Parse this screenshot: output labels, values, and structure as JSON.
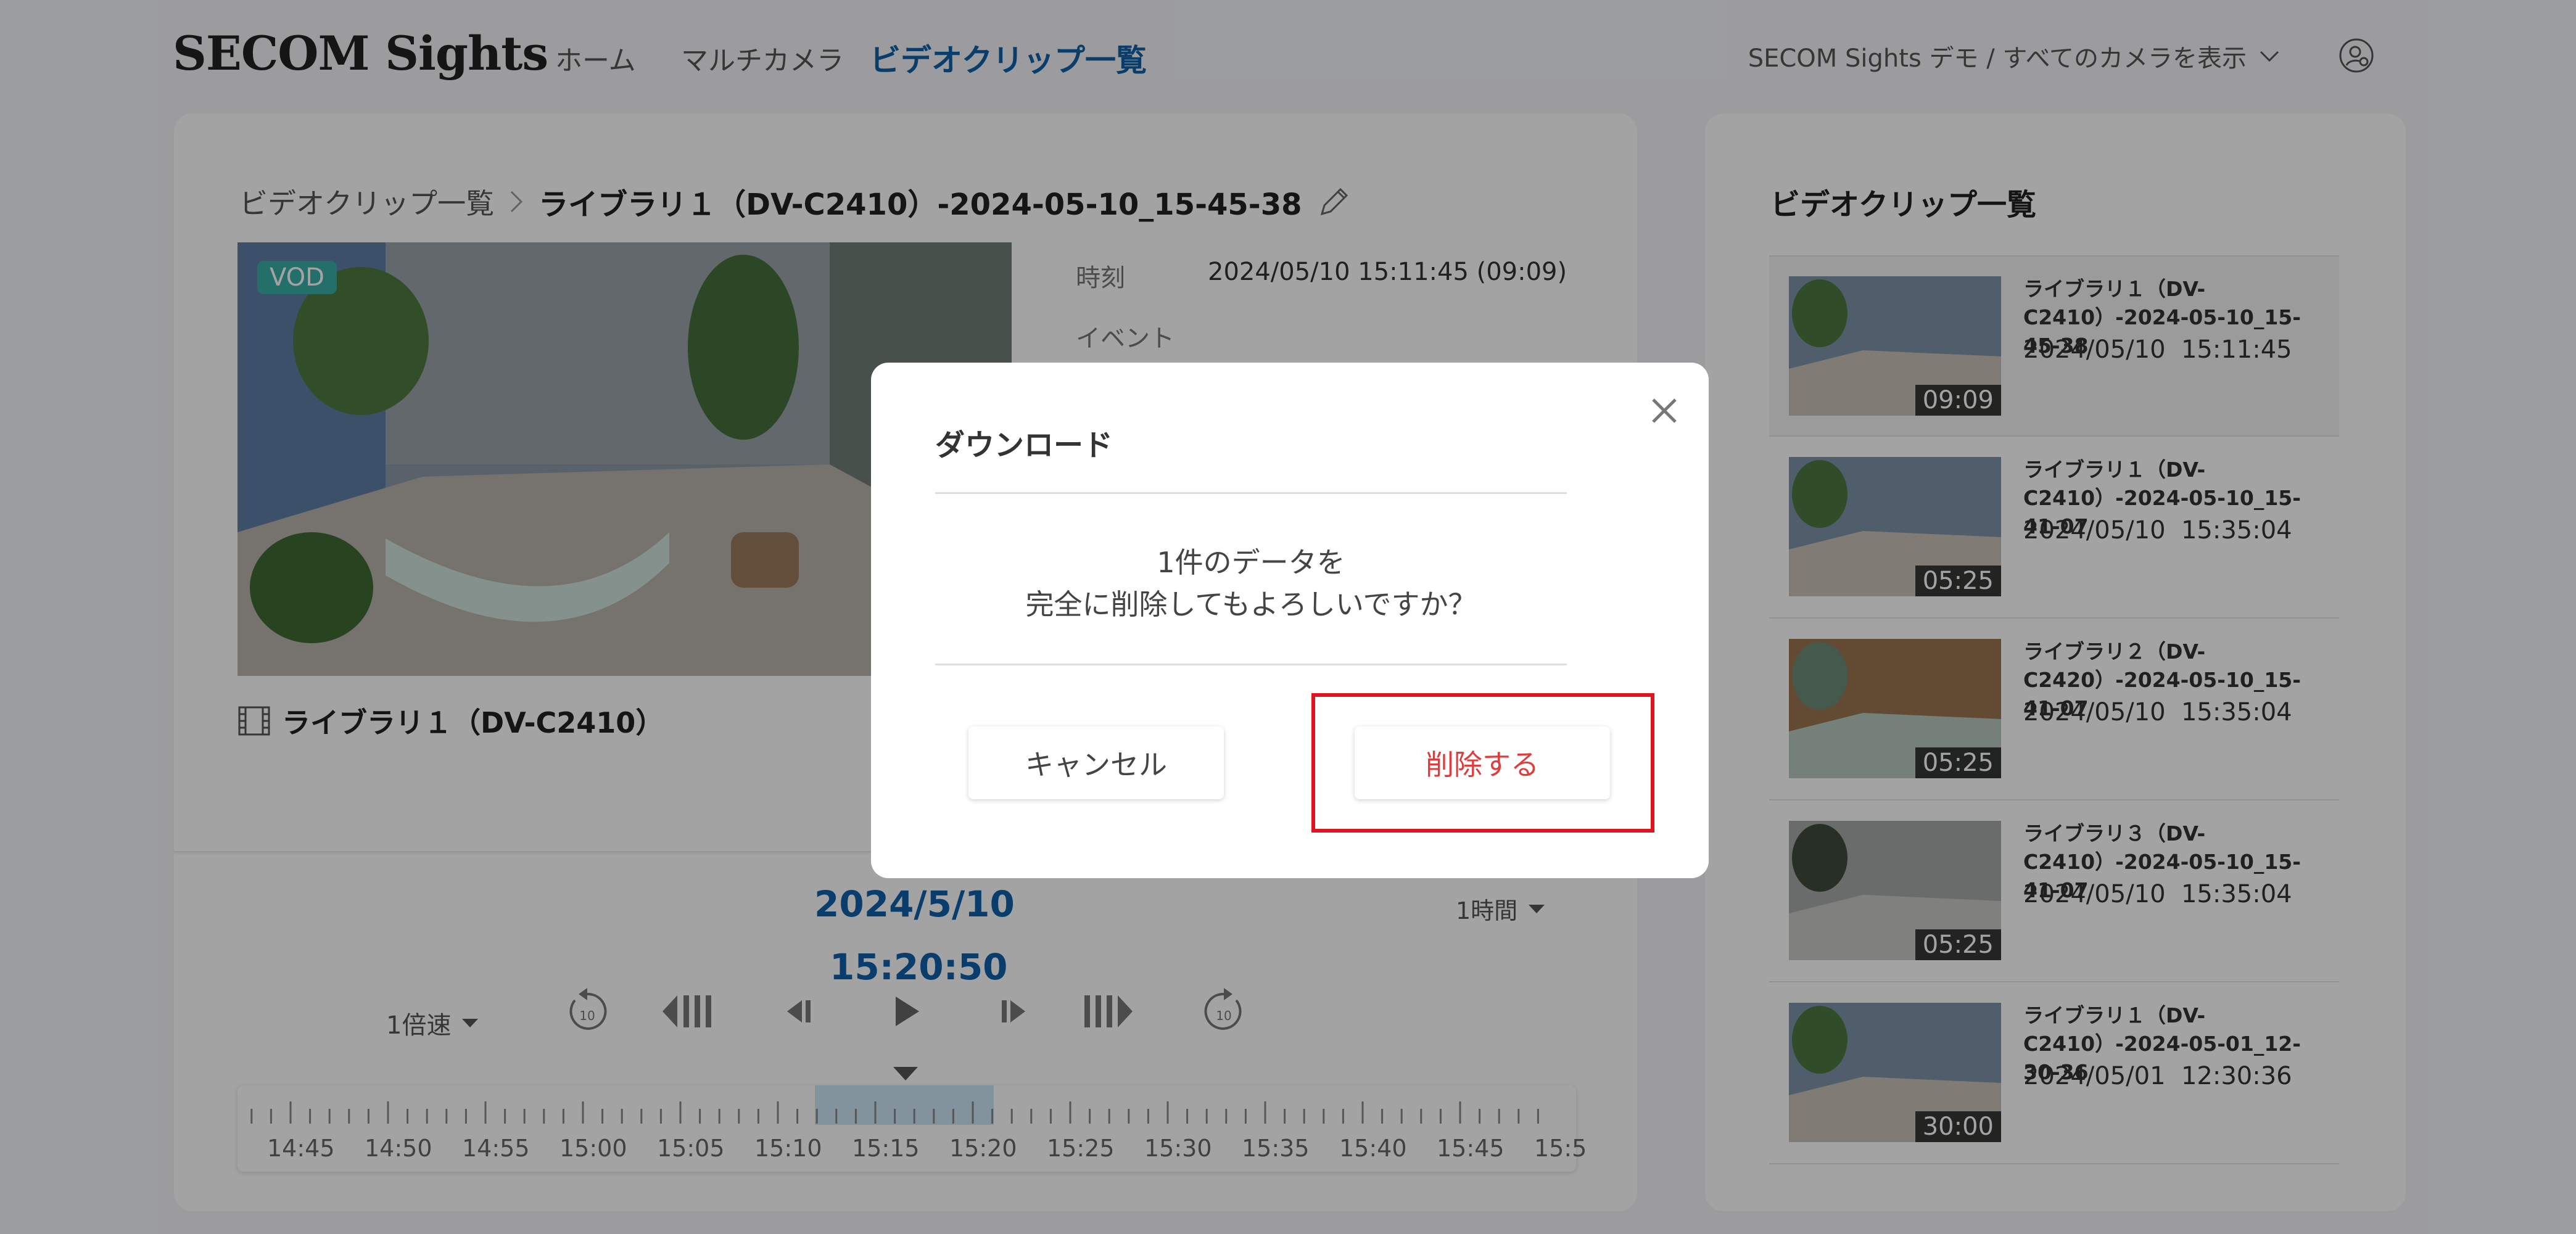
{
  "header": {
    "logo": "SECOM Sights",
    "nav": [
      "ホーム",
      "マルチカメラ",
      "ビデオクリップ一覧"
    ],
    "account_selector": "SECOM Sights デモ / すべてのカメラを表示"
  },
  "breadcrumb": {
    "parent": "ビデオクリップ一覧",
    "current": "ライブラリ１（DV-C2410）-2024-05-10_15-45-38"
  },
  "video": {
    "badge": "VOD",
    "camera_name": "ライブラリ１（DV-C2410）"
  },
  "meta": {
    "time_label": "時刻",
    "time_value": "2024/05/10 15:11:45 (09:09)",
    "event_label": "イベント"
  },
  "player": {
    "date": "2024/5/10",
    "time": "15:20:50",
    "range": "1時間",
    "speed": "1倍速",
    "timeline_labels": [
      "14:45",
      "14:50",
      "14:55",
      "15:00",
      "15:05",
      "15:10",
      "15:15",
      "15:20",
      "15:25",
      "15:30",
      "15:35",
      "15:40",
      "15:45",
      "15:5"
    ]
  },
  "clip_list": {
    "title": "ビデオクリップ一覧",
    "items": [
      {
        "name": "ライブラリ１（DV-C2410）-2024-05-10_15-45-38",
        "date": "2024/05/10  15:11:45",
        "duration": "09:09",
        "selected": true
      },
      {
        "name": "ライブラリ１（DV-C2410）-2024-05-10_15-41-07",
        "date": "2024/05/10  15:35:04",
        "duration": "05:25",
        "selected": false
      },
      {
        "name": "ライブラリ２（DV-C2420）-2024-05-10_15-41-07",
        "date": "2024/05/10  15:35:04",
        "duration": "05:25",
        "selected": false
      },
      {
        "name": "ライブラリ３（DV-C2410）-2024-05-10_15-41-07",
        "date": "2024/05/10  15:35:04",
        "duration": "05:25",
        "selected": false
      },
      {
        "name": "ライブラリ１（DV-C2410）-2024-05-01_12-30-36",
        "date": "2024/05/01  12:30:36",
        "duration": "30:00",
        "selected": false
      }
    ]
  },
  "modal": {
    "title": "ダウンロード",
    "message_line1": "1件のデータを",
    "message_line2": "完全に削除してもよろしいですか？",
    "cancel_label": "キャンセル",
    "delete_label": "削除する"
  },
  "colors": {
    "accent": "#0f60a8",
    "danger": "#e03c3c",
    "highlight": "#e0141e",
    "vod": "#3aaea7"
  }
}
